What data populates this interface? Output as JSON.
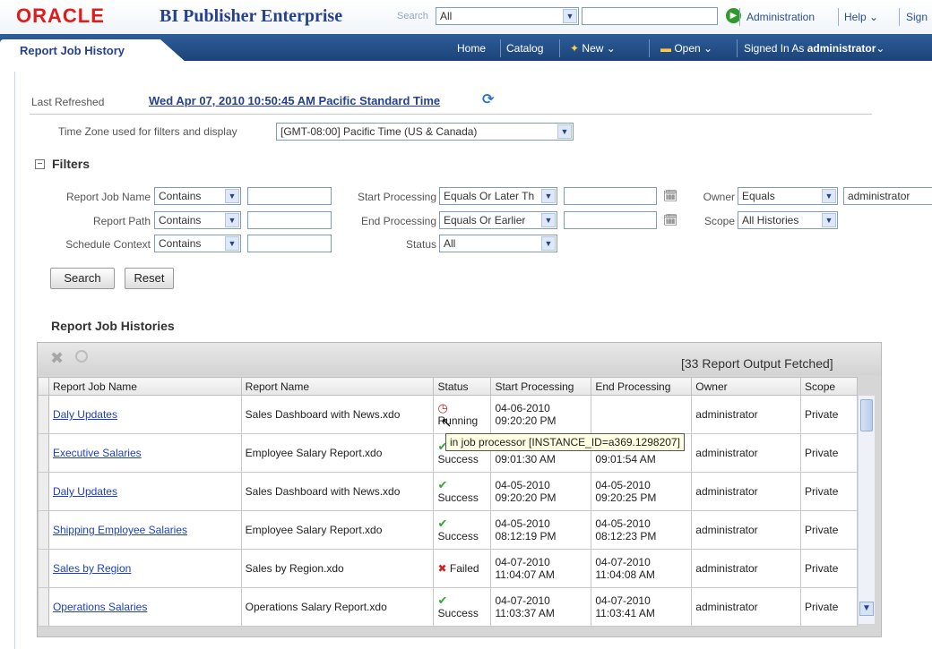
{
  "header": {
    "logo": "ORACLE",
    "product": "BI Publisher Enterprise",
    "search_label": "Search",
    "search_scope": "All",
    "search_value": "",
    "links": [
      "Administration",
      "Help",
      "Sign"
    ]
  },
  "nav": {
    "active_tab": "Report Job History",
    "home": "Home",
    "catalog": "Catalog",
    "new": "New",
    "open": "Open",
    "signed_in_as_label": "Signed In As",
    "user": "administrator"
  },
  "page": {
    "last_refreshed_label": "Last Refreshed",
    "last_refreshed_value": "Wed Apr 07, 2010 10:50:45 AM Pacific Standard Time",
    "tz_label": "Time Zone used for filters and display",
    "tz_value": "[GMT-08:00] Pacific Time (US & Canada)"
  },
  "filters": {
    "heading": "Filters",
    "report_job_name_label": "Report Job Name",
    "report_job_name_op": "Contains",
    "report_path_label": "Report Path",
    "report_path_op": "Contains",
    "schedule_context_label": "Schedule Context",
    "schedule_context_op": "Contains",
    "start_processing_label": "Start Processing",
    "start_processing_op": "Equals Or Later Th",
    "end_processing_label": "End Processing",
    "end_processing_op": "Equals Or Earlier",
    "status_label": "Status",
    "status_value": "All",
    "owner_label": "Owner",
    "owner_op": "Equals",
    "owner_value": "administrator",
    "scope_label": "Scope",
    "scope_value": "All Histories",
    "search_button": "Search",
    "reset_button": "Reset"
  },
  "histories": {
    "heading": "Report Job Histories",
    "fetched": "[33 Report Output Fetched]",
    "columns": [
      "Report Job Name",
      "Report Name",
      "Status",
      "Start Processing",
      "End Processing",
      "Owner",
      "Scope"
    ],
    "rows": [
      {
        "job": "Daly Updates",
        "report": "Sales Dashboard with News.xdo",
        "status": "Running",
        "status_icon": "clock-icon",
        "start_date": "04-06-2010",
        "start_time": "09:20:20 PM",
        "end_date": "",
        "end_time": "",
        "owner": "administrator",
        "scope": "Private"
      },
      {
        "job": "Executive Salaries",
        "report": "Employee Salary Report.xdo",
        "status": "Success",
        "status_icon": "check-icon",
        "start_date": "04-05-2010",
        "start_time": "09:01:30 AM",
        "end_date": "04-05-2010",
        "end_time": "09:01:54 AM",
        "owner": "administrator",
        "scope": "Private"
      },
      {
        "job": "Daly Updates",
        "report": "Sales Dashboard with News.xdo",
        "status": "Success",
        "status_icon": "check-icon",
        "start_date": "04-05-2010",
        "start_time": "09:20:20 PM",
        "end_date": "04-05-2010",
        "end_time": "09:20:25 PM",
        "owner": "administrator",
        "scope": "Private"
      },
      {
        "job": "Shipping Employee Salaries",
        "report": "Employee Salary Report.xdo",
        "status": "Success",
        "status_icon": "check-icon",
        "start_date": "04-05-2010",
        "start_time": "08:12:19 PM",
        "end_date": "04-05-2010",
        "end_time": "08:12:23 PM",
        "owner": "administrator",
        "scope": "Private"
      },
      {
        "job": "Sales by Region",
        "report": "Sales by Region.xdo",
        "status": "Failed",
        "status_icon": "x-icon",
        "start_date": "04-07-2010",
        "start_time": "11:04:07 AM",
        "end_date": "04-07-2010",
        "end_time": "11:04:08 AM",
        "owner": "administrator",
        "scope": "Private"
      },
      {
        "job": "Operations Salaries",
        "report": "Operations Salary Report.xdo",
        "status": "Success",
        "status_icon": "check-icon",
        "start_date": "04-07-2010",
        "start_time": "11:03:37 AM",
        "end_date": "04-07-2010",
        "end_time": "11:03:41 AM",
        "owner": "administrator",
        "scope": "Private"
      }
    ],
    "tooltip": "in job processor [INSTANCE_ID=a369.1298207]"
  }
}
